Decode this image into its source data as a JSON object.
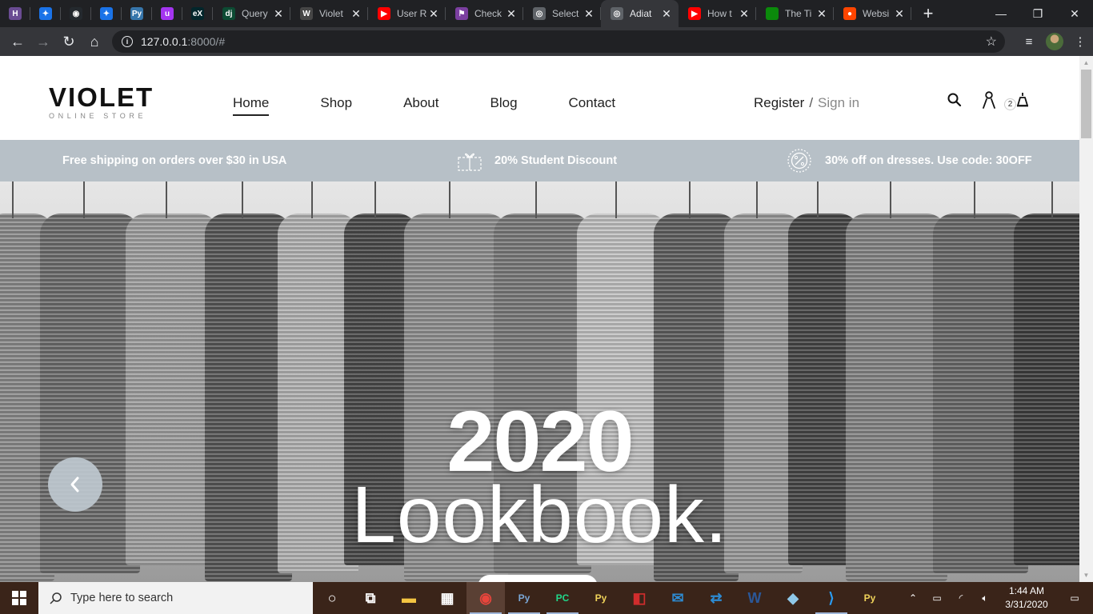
{
  "browser": {
    "pinned_tabs": [
      {
        "icon": "h-app-icon",
        "letter": "H",
        "color": "#6a4c93"
      },
      {
        "icon": "star-app-icon",
        "letter": "✦",
        "color": "#1a73e8"
      },
      {
        "icon": "github-icon",
        "letter": "◉",
        "color": "#24292e"
      },
      {
        "icon": "star-app-icon",
        "letter": "✦",
        "color": "#1a73e8"
      },
      {
        "icon": "python-icon",
        "letter": "Py",
        "color": "#3776ab"
      },
      {
        "icon": "udemy-icon",
        "letter": "u",
        "color": "#a435f0"
      },
      {
        "icon": "edx-icon",
        "letter": "eX",
        "color": "#02262b"
      }
    ],
    "tabs": [
      {
        "title": "Query",
        "icon": "django-icon",
        "favicon_text": "dj",
        "color": "#0c4b33",
        "active": false
      },
      {
        "title": "Violet",
        "icon": "wordpress-icon",
        "favicon_text": "W",
        "color": "#464646",
        "active": false
      },
      {
        "title": "User R",
        "icon": "youtube-icon",
        "favicon_text": "▶",
        "color": "#ff0000",
        "active": false
      },
      {
        "title": "Check",
        "icon": "generic-tab-icon",
        "favicon_text": "⚑",
        "color": "#7b3fa0",
        "active": false
      },
      {
        "title": "Select",
        "icon": "globe-icon",
        "favicon_text": "◎",
        "color": "#5f6368",
        "active": false
      },
      {
        "title": "Adiat",
        "icon": "globe-icon",
        "favicon_text": "◎",
        "color": "#5f6368",
        "active": true
      },
      {
        "title": "How t",
        "icon": "youtube-icon",
        "favicon_text": "▶",
        "color": "#ff0000",
        "active": false
      },
      {
        "title": "The Ti",
        "icon": "green-square-icon",
        "favicon_text": "",
        "color": "#0b8a0b",
        "active": false
      },
      {
        "title": "Websi",
        "icon": "reddit-icon",
        "favicon_text": "●",
        "color": "#ff4500",
        "active": false
      }
    ],
    "new_tab_label": "+",
    "url_host": "127.0.0.1",
    "url_rest": ":8000/#"
  },
  "site": {
    "logo": {
      "main": "VIOLET",
      "sub": "ONLINE STORE"
    },
    "nav": [
      {
        "label": "Home",
        "current": true
      },
      {
        "label": "Shop",
        "current": false
      },
      {
        "label": "About",
        "current": false
      },
      {
        "label": "Blog",
        "current": false
      },
      {
        "label": "Contact",
        "current": false
      }
    ],
    "auth": {
      "register": "Register",
      "separator": "/",
      "signin": "Sign in"
    },
    "cart_count": "2",
    "promo": [
      {
        "text": "Free shipping on orders over $30 in USA",
        "icon": null
      },
      {
        "text": "20% Student Discount",
        "icon": "gift-icon"
      },
      {
        "text": "30% off on dresses. Use code: 30OFF",
        "icon": "percent-badge-icon"
      }
    ],
    "hero": {
      "year": "2020",
      "subtitle": "Lookbook."
    }
  },
  "taskbar": {
    "search_placeholder": "Type here to search",
    "apps": [
      {
        "name": "cortana-icon",
        "glyph": "○",
        "color": "#ffffff",
        "active": false
      },
      {
        "name": "task-view-icon",
        "glyph": "⧉",
        "color": "#ffffff",
        "active": false
      },
      {
        "name": "file-explorer-icon",
        "glyph": "▬",
        "color": "#f4c542",
        "active": false
      },
      {
        "name": "store-icon",
        "glyph": "▦",
        "color": "#ffffff",
        "active": false
      },
      {
        "name": "chrome-icon",
        "glyph": "◉",
        "color": "#e8453c",
        "active": true
      },
      {
        "name": "python-idle-icon",
        "glyph": "Py",
        "color": "#7aa7d6",
        "active": false
      },
      {
        "name": "pycharm-icon",
        "glyph": "PC",
        "color": "#21d789",
        "active": false
      },
      {
        "name": "python-file-icon",
        "glyph": "Py",
        "color": "#f0d35a",
        "active": false
      },
      {
        "name": "app-red-icon",
        "glyph": "◧",
        "color": "#d12d2d",
        "active": false
      },
      {
        "name": "mail-icon",
        "glyph": "✉",
        "color": "#2d8ad1",
        "active": false
      },
      {
        "name": "teamviewer-icon",
        "glyph": "⇄",
        "color": "#2d8ad1",
        "active": false
      },
      {
        "name": "word-icon",
        "glyph": "W",
        "color": "#2b5797",
        "active": false
      },
      {
        "name": "app-blue-icon",
        "glyph": "◆",
        "color": "#8fc8e8",
        "active": false
      },
      {
        "name": "vscode-icon",
        "glyph": "⟩",
        "color": "#2a9df4",
        "active": false
      },
      {
        "name": "python-launcher-icon",
        "glyph": "Py",
        "color": "#f0d35a",
        "active": false
      }
    ],
    "time": "1:44 AM",
    "date": "3/31/2020"
  }
}
